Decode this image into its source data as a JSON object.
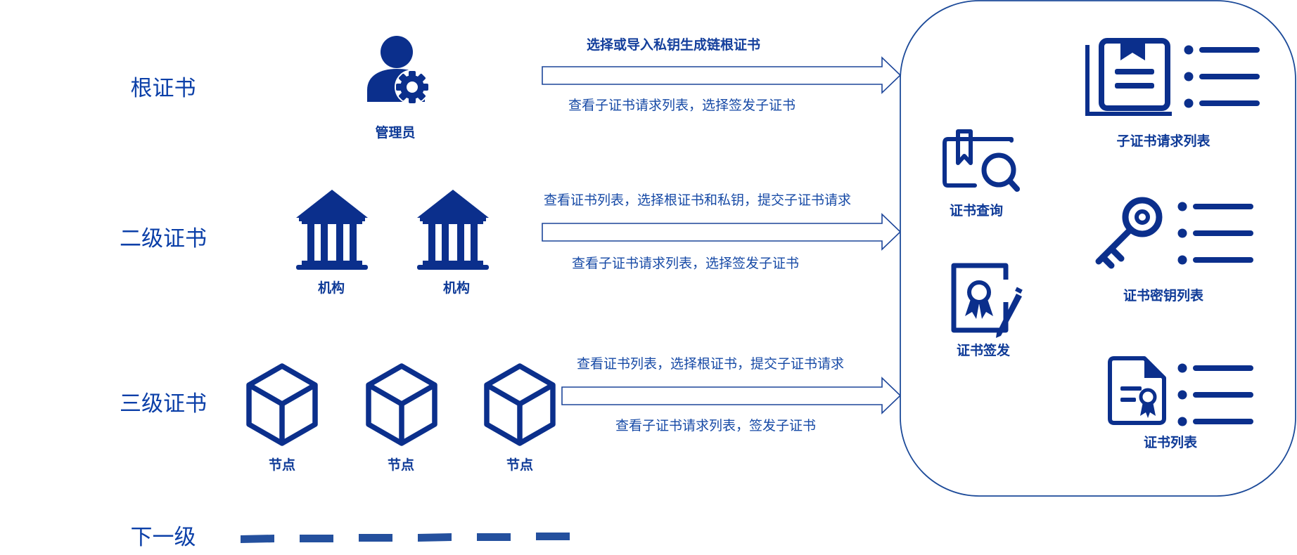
{
  "levels": {
    "root": "根证书",
    "second": "二级证书",
    "third": "三级证书",
    "next": "下一级"
  },
  "actors": {
    "admin": "管理员",
    "institution": "机构",
    "node": "节点"
  },
  "transitions": {
    "root_to": "选择或导入私钥生成链根证书",
    "root_from": "查看子证书请求列表，选择签发子证书",
    "second_to": "查看证书列表，选择根证书和私钥，提交子证书请求",
    "second_from": "查看子证书请求列表，选择签发子证书",
    "third_to": "查看证书列表，选择根证书，提交子证书请求",
    "third_from": "查看子证书请求列表，签发子证书"
  },
  "functions": {
    "query": "证书查询",
    "issue": "证书签发",
    "request_list": "子证书请求列表",
    "key_list": "证书密钥列表",
    "cert_list": "证书列表"
  }
}
